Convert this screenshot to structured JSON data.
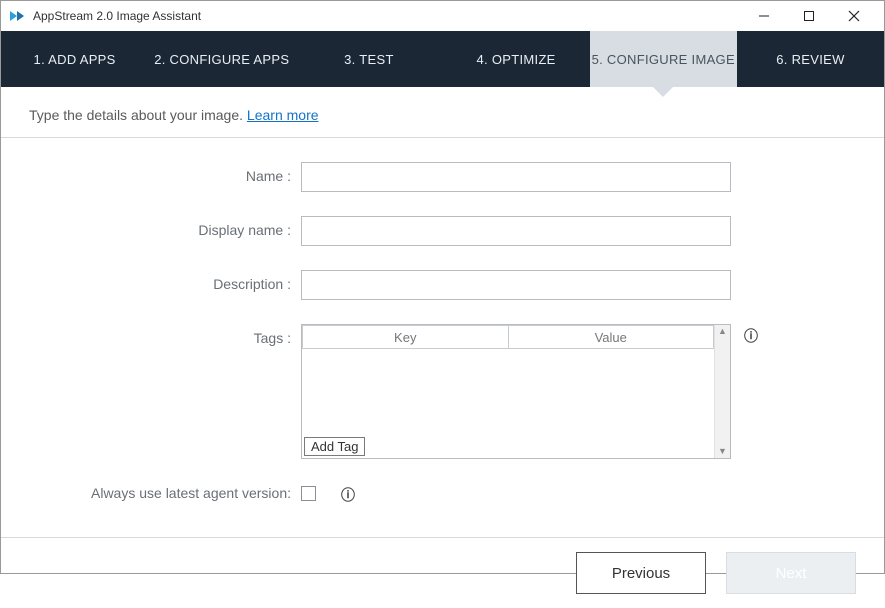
{
  "window": {
    "title": "AppStream 2.0 Image Assistant"
  },
  "tabs": [
    {
      "label": "1. ADD APPS"
    },
    {
      "label": "2. CONFIGURE APPS"
    },
    {
      "label": "3. TEST"
    },
    {
      "label": "4. OPTIMIZE"
    },
    {
      "label": "5. CONFIGURE IMAGE"
    },
    {
      "label": "6. REVIEW"
    }
  ],
  "active_tab_index": 4,
  "intro": {
    "text": "Type the details about your image. ",
    "link": "Learn more"
  },
  "fields": {
    "name": {
      "label": "Name :",
      "value": ""
    },
    "display_name": {
      "label": "Display name :",
      "value": ""
    },
    "description": {
      "label": "Description :",
      "value": ""
    },
    "tags": {
      "label": "Tags :",
      "columns": {
        "key": "Key",
        "value": "Value"
      },
      "add_button": "Add Tag"
    },
    "latest_agent": {
      "label": "Always use latest agent version:",
      "checked": false
    }
  },
  "footer": {
    "previous": "Previous",
    "next": "Next"
  }
}
